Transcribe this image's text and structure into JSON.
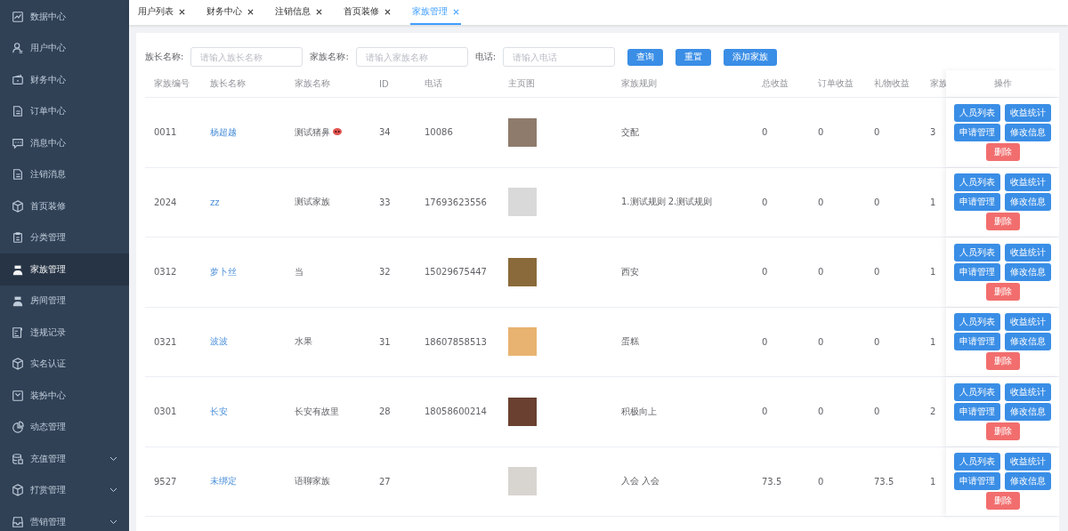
{
  "sidebar": {
    "items": [
      {
        "label": "数据中心",
        "kind": "link",
        "selected": false
      },
      {
        "label": "用户中心",
        "kind": "link",
        "selected": false
      },
      {
        "label": "财务中心",
        "kind": "link",
        "selected": false
      },
      {
        "label": "订单中心",
        "kind": "link",
        "selected": false
      },
      {
        "label": "消息中心",
        "kind": "link",
        "selected": false
      },
      {
        "label": "注销消息",
        "kind": "link",
        "selected": false
      },
      {
        "label": "首页装修",
        "kind": "link",
        "selected": false
      },
      {
        "label": "分类管理",
        "kind": "link",
        "selected": false
      },
      {
        "label": "家族管理",
        "kind": "link",
        "selected": true
      },
      {
        "label": "房间管理",
        "kind": "link",
        "selected": false
      },
      {
        "label": "违规记录",
        "kind": "link",
        "selected": false
      },
      {
        "label": "实名认证",
        "kind": "link",
        "selected": false
      },
      {
        "label": "装扮中心",
        "kind": "link",
        "selected": false
      },
      {
        "label": "动态管理",
        "kind": "link",
        "selected": false
      },
      {
        "label": "充值管理",
        "kind": "submenu",
        "selected": false
      },
      {
        "label": "打赏管理",
        "kind": "submenu",
        "selected": false
      },
      {
        "label": "营销管理",
        "kind": "submenu",
        "selected": false
      }
    ]
  },
  "tabs": [
    {
      "label": "用户列表",
      "selected": false
    },
    {
      "label": "财务中心",
      "selected": false
    },
    {
      "label": "注销信息",
      "selected": false
    },
    {
      "label": "首页装修",
      "selected": false
    },
    {
      "label": "家族管理",
      "selected": true
    }
  ],
  "filters": [
    {
      "label": "族长名称:",
      "placeholder": "请输入族长名称"
    },
    {
      "label": "家族名称:",
      "placeholder": "请输入家族名称"
    },
    {
      "label": "电话:",
      "placeholder": "请输入电话"
    }
  ],
  "filter_buttons": [
    "查询",
    "重置",
    "添加家族"
  ],
  "table": {
    "columns": [
      "家族编号",
      "族长名称",
      "家族名称",
      "ID",
      "电话",
      "主页图",
      "家族规则",
      "总收益",
      "订单收益",
      "礼物收益",
      "家族",
      "操作"
    ],
    "rows": [
      {
        "cells": [
          "0011",
          "杨超越",
          "测试猪鼻",
          "34",
          "10086",
          "",
          "交配",
          "0",
          "0",
          "0",
          "3"
        ],
        "name_badge": true,
        "actions": [
          "人员列表",
          "收益统计",
          "申请管理",
          "修改信息",
          "删除"
        ]
      },
      {
        "cells": [
          "2024",
          "zz",
          "测试家族",
          "33",
          "17693623556",
          "",
          "1.测试规则 2.测试规则",
          "0",
          "0",
          "0",
          "1"
        ],
        "name_badge": false,
        "actions": [
          "人员列表",
          "收益统计",
          "申请管理",
          "修改信息",
          "删除"
        ]
      },
      {
        "cells": [
          "0312",
          "萝卜丝",
          "当",
          "32",
          "15029675447",
          "",
          "西安",
          "0",
          "0",
          "0",
          "1"
        ],
        "name_badge": false,
        "actions": [
          "人员列表",
          "收益统计",
          "申请管理",
          "修改信息",
          "删除"
        ]
      },
      {
        "cells": [
          "0321",
          "波波",
          "水果",
          "31",
          "18607858513",
          "",
          "蛋糕",
          "0",
          "0",
          "0",
          "1"
        ],
        "name_badge": false,
        "actions": [
          "人员列表",
          "收益统计",
          "申请管理",
          "修改信息",
          "删除"
        ]
      },
      {
        "cells": [
          "0301",
          "长安",
          "长安有故里",
          "28",
          "18058600214",
          "",
          "积极向上",
          "0",
          "0",
          "0",
          "2"
        ],
        "name_badge": false,
        "actions": [
          "人员列表",
          "收益统计",
          "申请管理",
          "修改信息",
          "删除"
        ]
      },
      {
        "cells": [
          "9527",
          "未绑定",
          "语聊家族",
          "27",
          "",
          "",
          "入会 入会",
          "73.5",
          "0",
          "73.5",
          "1"
        ],
        "name_badge": false,
        "actions": [
          "人员列表",
          "收益统计",
          "申请管理",
          "修改信息",
          "删除"
        ]
      }
    ]
  }
}
